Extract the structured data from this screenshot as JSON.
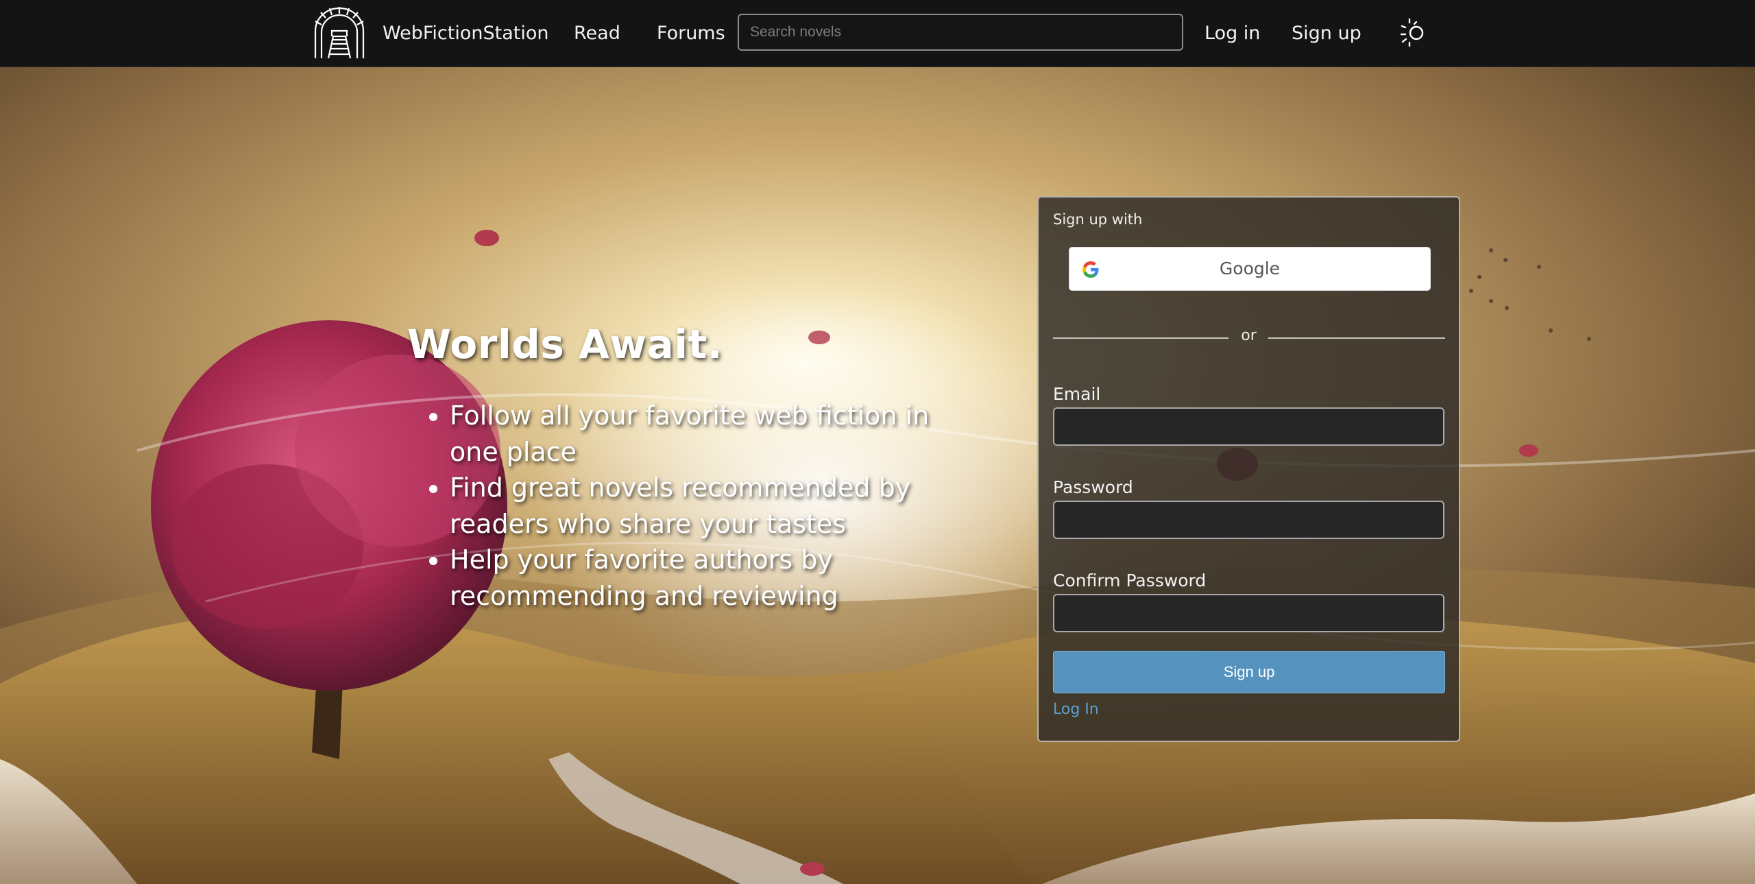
{
  "header": {
    "brand": "WebFictionStation",
    "nav_read": "Read",
    "nav_forums": "Forums",
    "search_placeholder": "Search novels",
    "nav_login": "Log in",
    "nav_signup": "Sign up",
    "theme_icon": "sun-moon-icon",
    "logo_icon": "tunnel-rail-logo"
  },
  "hero": {
    "headline": "Worlds Await.",
    "features": [
      "Follow all your favorite web fiction in one place",
      "Find great novels recommended by readers who share your tastes",
      "Help your favorite authors by recommending and reviewing"
    ]
  },
  "signup_card": {
    "heading": "Sign up with",
    "google_label": "Google",
    "divider": "or",
    "email_label": "Email",
    "password_label": "Password",
    "confirm_label": "Confirm Password",
    "email_value": "",
    "password_value": "",
    "confirm_value": "",
    "submit_label": "Sign up",
    "login_link": "Log In"
  },
  "colors": {
    "topbar": "#141414",
    "primary_button": "#5593be",
    "link": "#5d9fd1"
  }
}
